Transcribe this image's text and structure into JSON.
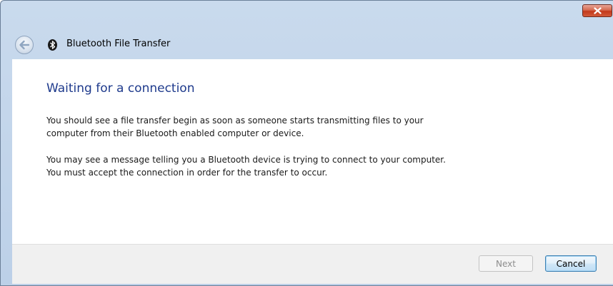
{
  "window": {
    "title": "Bluetooth File Transfer"
  },
  "icons": {
    "close": "close-icon",
    "back": "back-arrow-icon",
    "app": "bluetooth-icon"
  },
  "content": {
    "heading": "Waiting for a connection",
    "paragraph1": [
      "You should see a file transfer begin as soon as someone starts transmitting files to your",
      "computer from their Bluetooth enabled computer or device."
    ],
    "paragraph2": [
      "You may see a message telling you a Bluetooth device is trying to connect to your computer.",
      "You must accept the connection in order for the transfer to occur."
    ]
  },
  "footer": {
    "next_label": "Next",
    "cancel_label": "Cancel"
  },
  "colors": {
    "heading": "#1e3a8c",
    "frame": "#bcd0e8",
    "close": "#c2381b"
  }
}
